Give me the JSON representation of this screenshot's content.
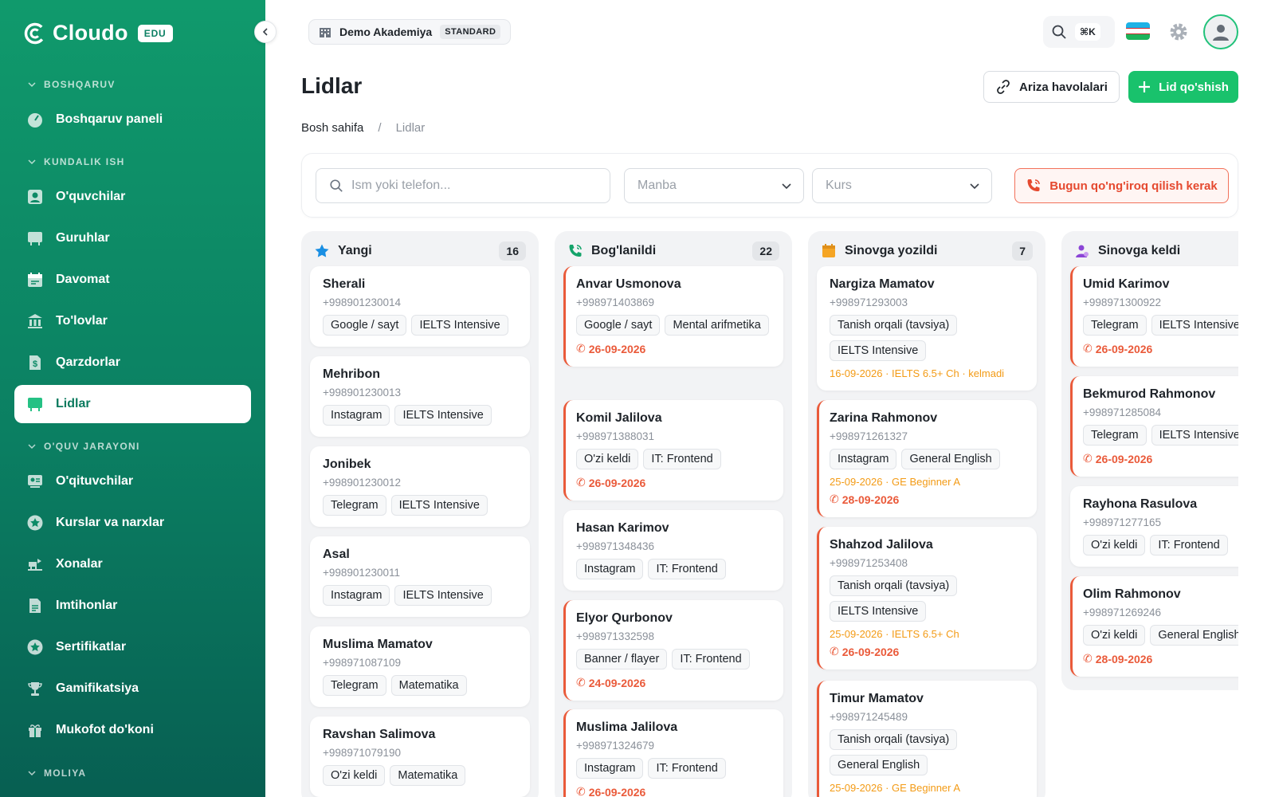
{
  "sidebar": {
    "brand_name": "Cloudo",
    "brand_badge": "EDU",
    "sections": {
      "boshqaruv": "BOSHQARUV",
      "kundalik": "KUNDALIK ISH",
      "oquv": "O'QUV JARAYONI",
      "moliya": "MOLIYA"
    },
    "items": [
      {
        "label": "Boshqaruv paneli",
        "icon": "dashboard-icon"
      },
      {
        "label": "O'quvchilar",
        "icon": "student-icon"
      },
      {
        "label": "Guruhlar",
        "icon": "board-icon"
      },
      {
        "label": "Davomat",
        "icon": "calendar-icon"
      },
      {
        "label": "To'lovlar",
        "icon": "bank-icon"
      },
      {
        "label": "Qarzdorlar",
        "icon": "dollar-doc-icon"
      },
      {
        "label": "Lidlar",
        "icon": "board-icon"
      },
      {
        "label": "O'qituvchilar",
        "icon": "teacher-icon"
      },
      {
        "label": "Kurslar va narxlar",
        "icon": "star-badge-icon"
      },
      {
        "label": "Xonalar",
        "icon": "room-icon"
      },
      {
        "label": "Imtihonlar",
        "icon": "document-icon"
      },
      {
        "label": "Sertifikatlar",
        "icon": "certificate-icon"
      },
      {
        "label": "Gamifikatsiya",
        "icon": "trophy-icon"
      },
      {
        "label": "Mukofot do'koni",
        "icon": "gift-icon"
      }
    ]
  },
  "topbar": {
    "org_name": "Demo Akademiya",
    "org_plan": "STANDARD",
    "search_shortcut": "⌘K"
  },
  "page": {
    "title": "Lidlar",
    "breadcrumb_home": "Bosh sahifa",
    "breadcrumb_sep": "/",
    "breadcrumb_current": "Lidlar",
    "btn_links": "Ariza havolalari",
    "btn_add": "Lid qo'shish"
  },
  "filters": {
    "search_placeholder": "Ism yoki telefon...",
    "source_placeholder": "Manba",
    "course_placeholder": "Kurs",
    "call_today": "Bugun qo'ng'iroq qilish kerak"
  },
  "columns": [
    {
      "title": "Yangi",
      "count": "16",
      "icon": "star-icon",
      "cards": [
        {
          "name": "Sherali",
          "phone": "+998901230014",
          "tags": [
            "Google / sayt",
            "IELTS Intensive"
          ]
        },
        {
          "name": "Mehribon",
          "phone": "+998901230013",
          "tags": [
            "Instagram",
            "IELTS Intensive"
          ]
        },
        {
          "name": "Jonibek",
          "phone": "+998901230012",
          "tags": [
            "Telegram",
            "IELTS Intensive"
          ]
        },
        {
          "name": "Asal",
          "phone": "+998901230011",
          "tags": [
            "Instagram",
            "IELTS Intensive"
          ]
        },
        {
          "name": "Muslima Mamatov",
          "phone": "+998971087109",
          "tags": [
            "Telegram",
            "Matematika"
          ]
        },
        {
          "name": "Ravshan Salimova",
          "phone": "+998971079190",
          "tags": [
            "O'zi keldi",
            "Matematika"
          ]
        }
      ]
    },
    {
      "title": "Bog'lanildi",
      "count": "22",
      "icon": "phone-icon",
      "cards": [
        {
          "name": "Anvar Usmonova",
          "phone": "+998971403869",
          "tags": [
            "Google / sayt",
            "Mental arifmetika"
          ],
          "due": "26-09-2026"
        },
        {
          "name": "Komil Jalilova",
          "phone": "+998971388031",
          "tags": [
            "O'zi keldi",
            "IT: Frontend"
          ],
          "due": "26-09-2026"
        },
        {
          "name": "Hasan Karimov",
          "phone": "+998971348436",
          "tags": [
            "Instagram",
            "IT: Frontend"
          ]
        },
        {
          "name": "Elyor Qurbonov",
          "phone": "+998971332598",
          "tags": [
            "Banner / flayer",
            "IT: Frontend"
          ],
          "due": "24-09-2026"
        },
        {
          "name": "Muslima Jalilova",
          "phone": "+998971324679",
          "tags": [
            "Instagram",
            "IT: Frontend"
          ],
          "due": "26-09-2026"
        }
      ]
    },
    {
      "title": "Sinovga yozildi",
      "count": "7",
      "icon": "calendar-icon",
      "cards": [
        {
          "name": "Nargiza Mamatov",
          "phone": "+998971293003",
          "tags": [
            "Tanish orqali (tavsiya)",
            "IELTS Intensive"
          ],
          "note": "16-09-2026 · IELTS 6.5+ Ch · kelmadi"
        },
        {
          "name": "Zarina Rahmonov",
          "phone": "+998971261327",
          "tags": [
            "Instagram",
            "General English"
          ],
          "note": "25-09-2026 · GE Beginner A",
          "due": "28-09-2026"
        },
        {
          "name": "Shahzod Jalilova",
          "phone": "+998971253408",
          "tags": [
            "Tanish orqali (tavsiya)",
            "IELTS Intensive"
          ],
          "note": "25-09-2026 · IELTS 6.5+ Ch",
          "due": "26-09-2026"
        },
        {
          "name": "Timur Mamatov",
          "phone": "+998971245489",
          "tags": [
            "Tanish orqali (tavsiya)",
            "General English"
          ],
          "note": "25-09-2026 · GE Beginner A"
        }
      ]
    },
    {
      "title": "Sinovga keldi",
      "count": "",
      "icon": "person-icon",
      "cards": [
        {
          "name": "Umid Karimov",
          "phone": "+998971300922",
          "tags": [
            "Telegram",
            "IELTS Intensive"
          ],
          "due": "26-09-2026"
        },
        {
          "name": "Bekmurod Rahmonov",
          "phone": "+998971285084",
          "tags": [
            "Telegram",
            "IELTS Intensive"
          ],
          "due": "26-09-2026"
        },
        {
          "name": "Rayhona Rasulova",
          "phone": "+998971277165",
          "tags": [
            "O'zi keldi",
            "IT: Frontend"
          ]
        },
        {
          "name": "Olim Rahmonov",
          "phone": "+998971269246",
          "tags": [
            "O'zi keldi",
            "General English"
          ],
          "due": "28-09-2026"
        }
      ]
    }
  ]
}
